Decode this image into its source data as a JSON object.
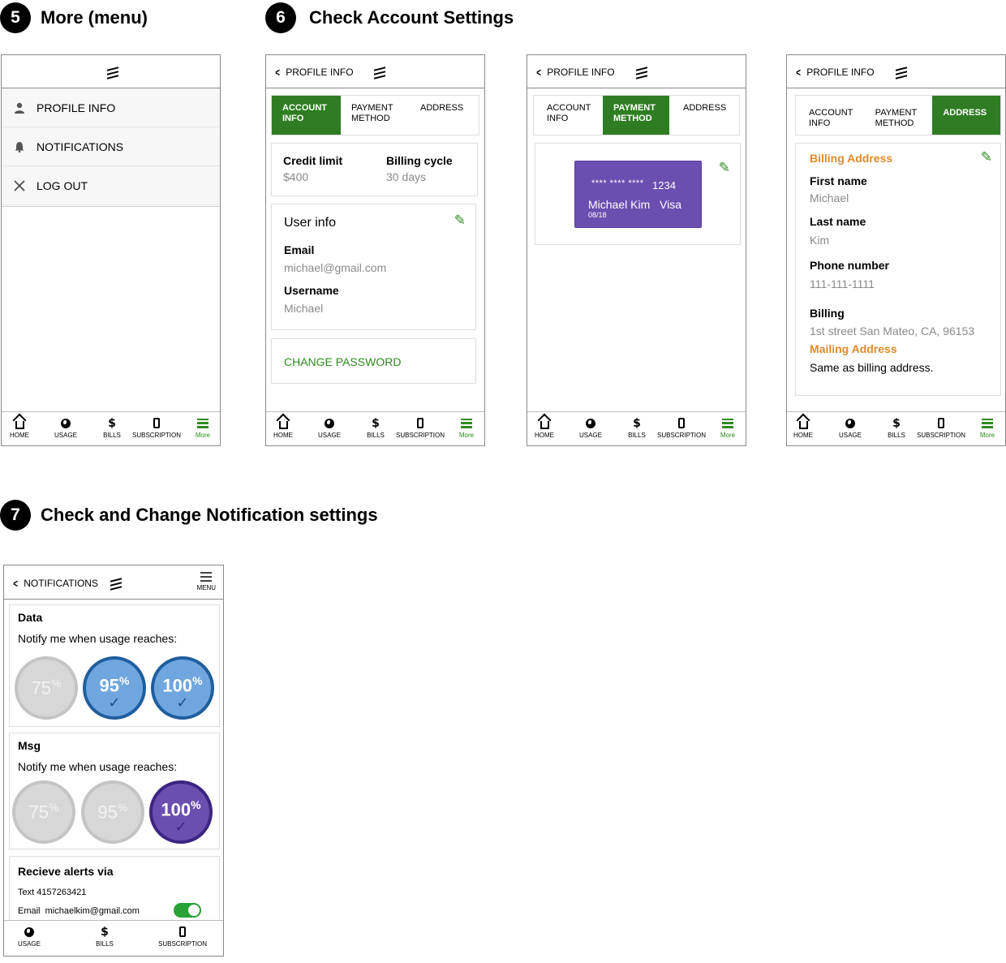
{
  "steps": {
    "s5": {
      "num": "5",
      "title": "More (menu)"
    },
    "s6": {
      "num": "6",
      "title": "Check Account Settings"
    },
    "s7": {
      "num": "7",
      "title": "Check and Change Notification settings"
    }
  },
  "tabbar": {
    "home": "HOME",
    "usage": "USAGE",
    "bills": "BILLS",
    "subscription": "SUBSCRIPTION",
    "more": "More"
  },
  "menu": {
    "items": [
      {
        "label": "PROFILE INFO",
        "icon": "person-icon"
      },
      {
        "label": "NOTIFICATIONS",
        "icon": "bell-icon"
      },
      {
        "label": "LOG OUT",
        "icon": "close-icon"
      }
    ]
  },
  "profile": {
    "back_label": "PROFILE INFO",
    "tabs": {
      "account": "ACCOUNT\nINFO",
      "payment": "PAYMENT\nMETHOD",
      "address": "ADDRESS"
    },
    "account": {
      "credit_limit_label": "Credit limit",
      "credit_limit": "$400",
      "billing_cycle_label": "Billing cycle",
      "billing_cycle": "30 days",
      "user_info_title": "User info",
      "email_label": "Email",
      "email": "michael@gmail.com",
      "username_label": "Username",
      "username": "Michael",
      "change_password": "CHANGE PASSWORD"
    },
    "payment": {
      "card_number": "**** **** ****",
      "card_last4": "1234",
      "card_name": "Michael Kim",
      "card_brand": "Visa",
      "card_expiry": "08/18",
      "card_color": "#6a4fb0"
    },
    "address": {
      "billing_title": "Billing Address",
      "first_name_label": "First name",
      "first_name": "Michael",
      "last_name_label": "Last name",
      "last_name": "Kim",
      "phone_label": "Phone number",
      "phone": "111-111-1111",
      "billing_label": "Billing",
      "billing": "1st street San Mateo, CA, 96153",
      "mailing_title": "Mailing Address",
      "mailing": "Same as billing address.",
      "accent_color": "#e08a2a"
    }
  },
  "notifications": {
    "back_label": "NOTIFICATIONS",
    "menu_label": "MENU",
    "data": {
      "title": "Data",
      "prompt": "Notify me when usage reaches:",
      "levels": [
        {
          "value": "75",
          "selected": false
        },
        {
          "value": "95",
          "selected": true
        },
        {
          "value": "100",
          "selected": true
        }
      ]
    },
    "msg": {
      "title": "Msg",
      "prompt": "Notify me when usage reaches:",
      "levels": [
        {
          "value": "75",
          "selected": false
        },
        {
          "value": "95",
          "selected": false
        },
        {
          "value": "100",
          "selected": true
        }
      ]
    },
    "alerts": {
      "title": "Recieve alerts via",
      "text_label": "Text",
      "text_value": "4157263421",
      "email_label": "Email",
      "email_value": "michaelkim@gmail.com",
      "email_enabled": true
    },
    "tabbar": {
      "usage": "USAGE",
      "bills": "BILLS",
      "subscription": "SUBSCRIPTION"
    }
  },
  "percent_sign": "%",
  "check_glyph": "✓",
  "colors": {
    "brand_green": "#2e7d22",
    "blue": "#6fa6de",
    "purple": "#6a4fb0",
    "orange": "#e08a2a"
  }
}
